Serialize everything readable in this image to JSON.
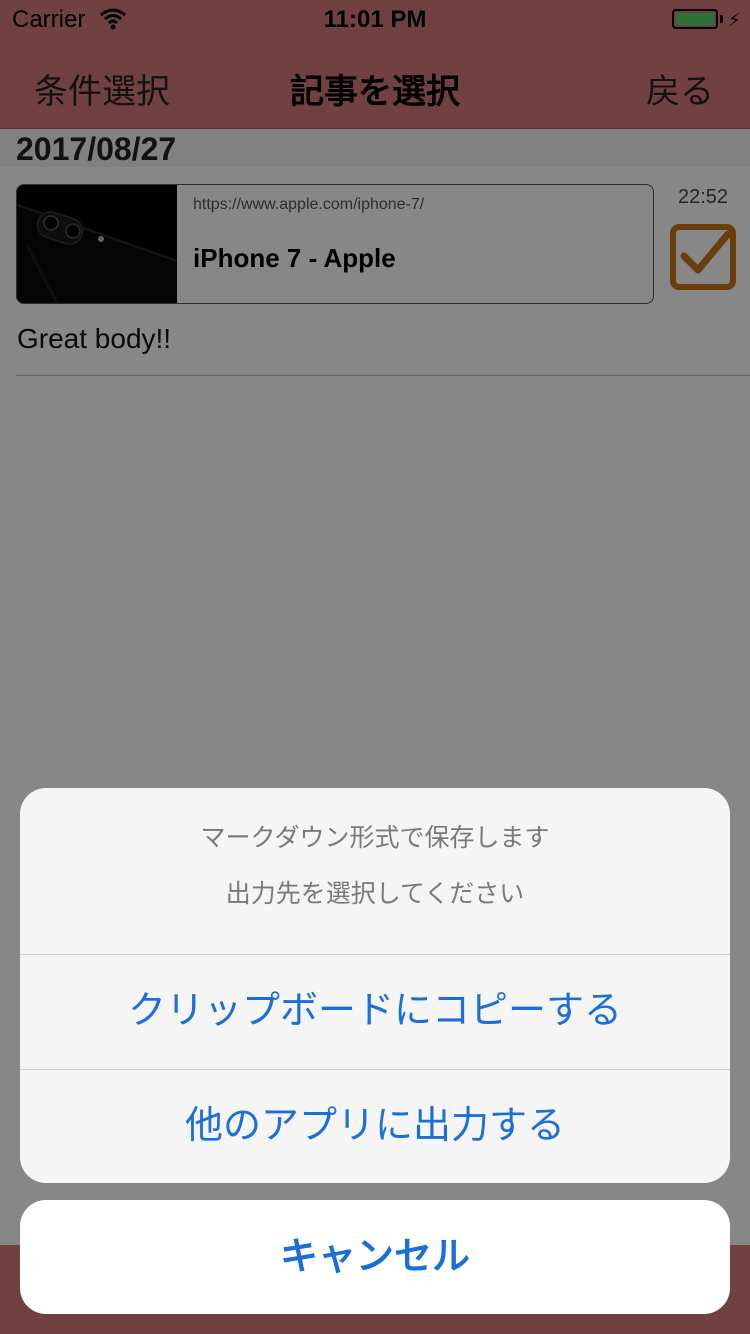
{
  "status_bar": {
    "carrier": "Carrier",
    "time": "11:01 PM"
  },
  "nav": {
    "left_label": "条件選択",
    "title": "記事を選択",
    "right_label": "戻る"
  },
  "feed": {
    "date": "2017/08/27",
    "items": [
      {
        "time": "22:52",
        "url": "https://www.apple.com/iphone-7/",
        "title": "iPhone 7 - Apple",
        "body": "Great body!!",
        "checked": true
      }
    ]
  },
  "action_sheet": {
    "title": "マークダウン形式で保存します",
    "message": "出力先を選択してください",
    "actions": [
      "クリップボードにコピーする",
      "他のアプリに出力する"
    ],
    "cancel": "キャンセル"
  },
  "colors": {
    "nav_bg": "#d67a7a",
    "accent": "#1a6fd8",
    "checkbox": "#c8741a",
    "battery": "#4cd964"
  }
}
